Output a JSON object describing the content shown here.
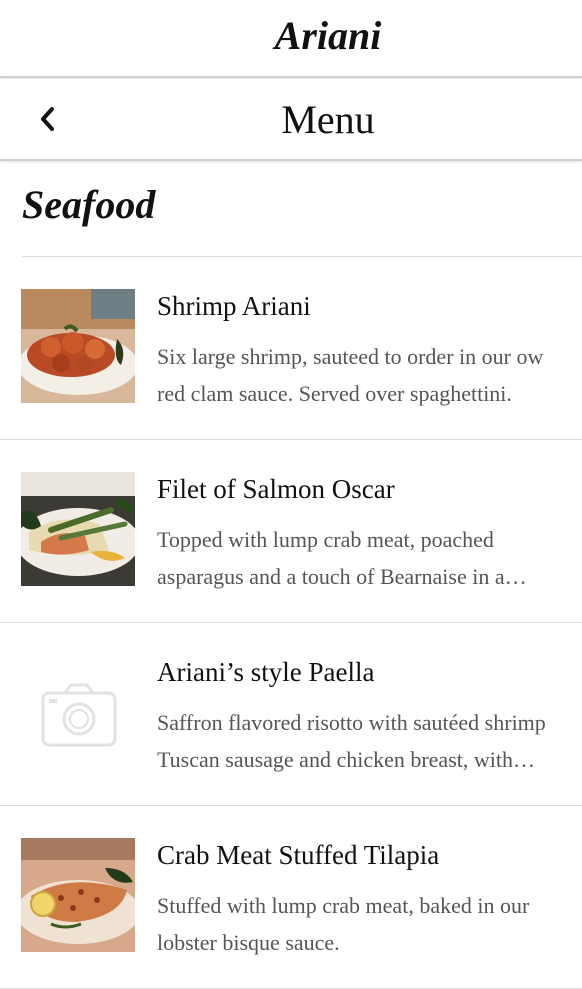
{
  "app": {
    "brand": "Ariani"
  },
  "nav": {
    "title": "Menu",
    "back_icon": "chevron-left-icon"
  },
  "section": {
    "title": "Seafood"
  },
  "items": [
    {
      "name": "Shrimp Ariani",
      "desc_line1": "Six large shrimp, sauteed to order in our ow",
      "desc_line2": "red clam sauce. Served over spaghettini.",
      "image": "shrimp-photo"
    },
    {
      "name": "Filet of Salmon Oscar",
      "desc_line1": "Topped with lump crab meat, poached",
      "desc_line2": "asparagus and a touch of Bearnaise in a…",
      "image": "salmon-photo"
    },
    {
      "name": "Ariani’s style Paella",
      "desc_line1": "Saffron flavored risotto with sautéed shrimp",
      "desc_line2": "Tuscan sausage and chicken breast, with…",
      "image": "camera-placeholder-icon"
    },
    {
      "name": "Crab Meat Stuffed Tilapia",
      "desc_line1": "Stuffed with lump crab meat, baked in our",
      "desc_line2": "lobster bisque sauce.",
      "image": "tilapia-photo"
    }
  ]
}
